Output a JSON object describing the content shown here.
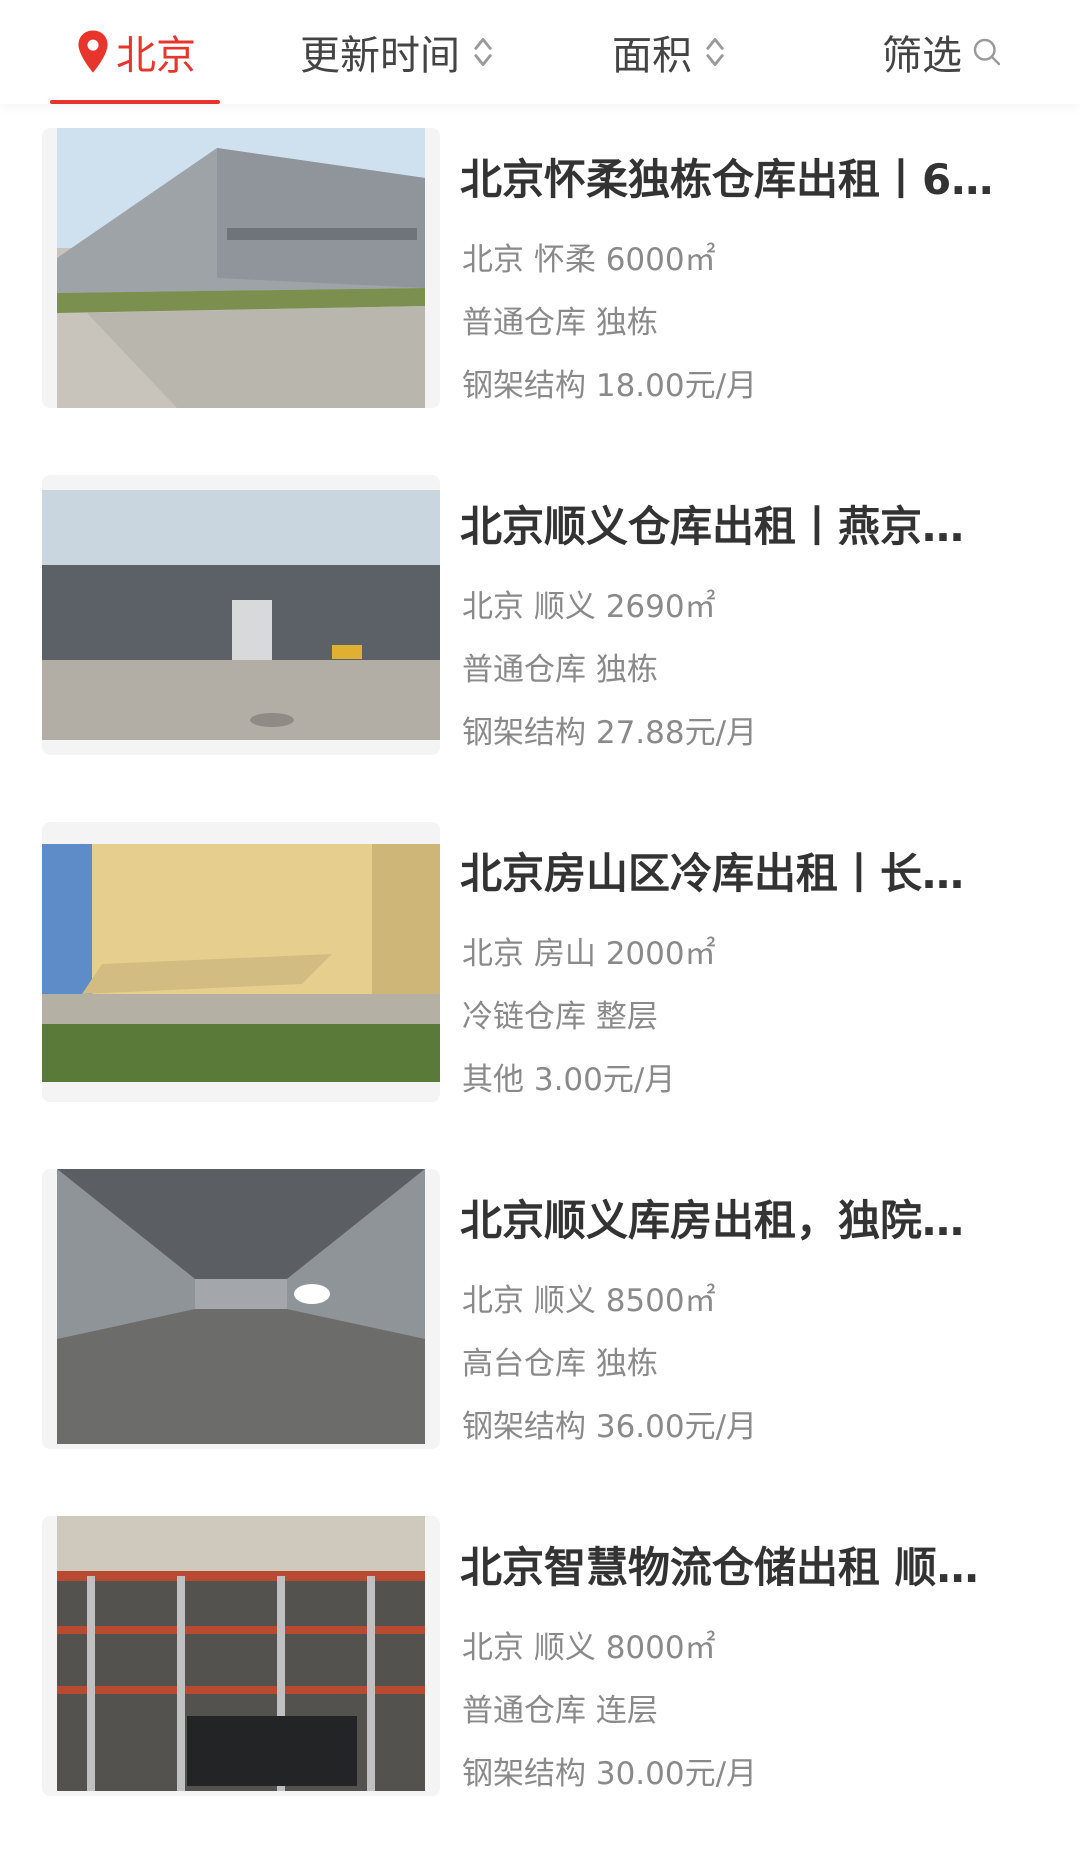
{
  "filter_bar": {
    "city": "北京",
    "update_time": "更新时间",
    "area": "面积",
    "filter": "筛选"
  },
  "listings": [
    {
      "title": "北京怀柔独栋仓库出租丨6…",
      "location": "北京 怀柔 6000㎡",
      "type": "普通仓库 独栋",
      "price": "钢架结构 18.00元/月"
    },
    {
      "title": "北京顺义仓库出租丨燕京…",
      "location": "北京 顺义 2690㎡",
      "type": "普通仓库 独栋",
      "price": "钢架结构 27.88元/月"
    },
    {
      "title": "北京房山区冷库出租丨长…",
      "location": "北京 房山 2000㎡",
      "type": "冷链仓库 整层",
      "price": "其他 3.00元/月"
    },
    {
      "title": "北京顺义库房出租，独院…",
      "location": "北京 顺义 8500㎡",
      "type": "高台仓库 独栋",
      "price": "钢架结构 36.00元/月"
    },
    {
      "title": "北京智慧物流仓储出租 顺…",
      "location": "北京 顺义 8000㎡",
      "type": "普通仓库 连层",
      "price": "钢架结构 30.00元/月"
    }
  ],
  "colors": {
    "accent": "#e8352b",
    "title_text": "#333333",
    "meta_text": "#8a8a8a"
  }
}
